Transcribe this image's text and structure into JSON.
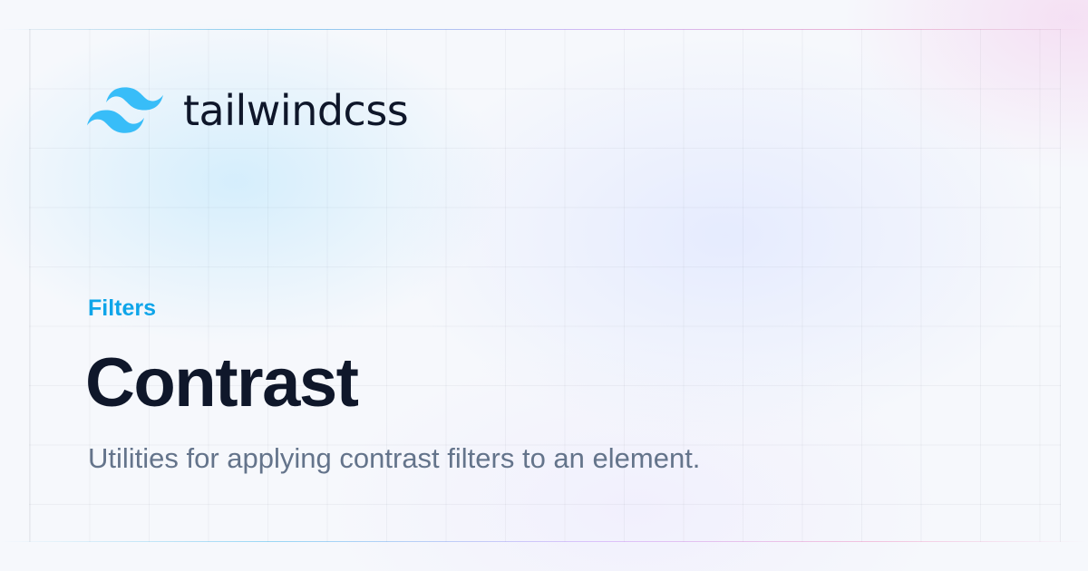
{
  "brand": {
    "logo_icon": "tailwind-wave-logo-icon",
    "wordmark": "tailwindcss",
    "logo_color": "#38bdf8"
  },
  "page": {
    "category": "Filters",
    "title": "Contrast",
    "description": "Utilities for applying contrast filters to an element."
  },
  "colors": {
    "accent": "#0ea5e9",
    "title": "#0f172a",
    "description": "#64748b"
  }
}
